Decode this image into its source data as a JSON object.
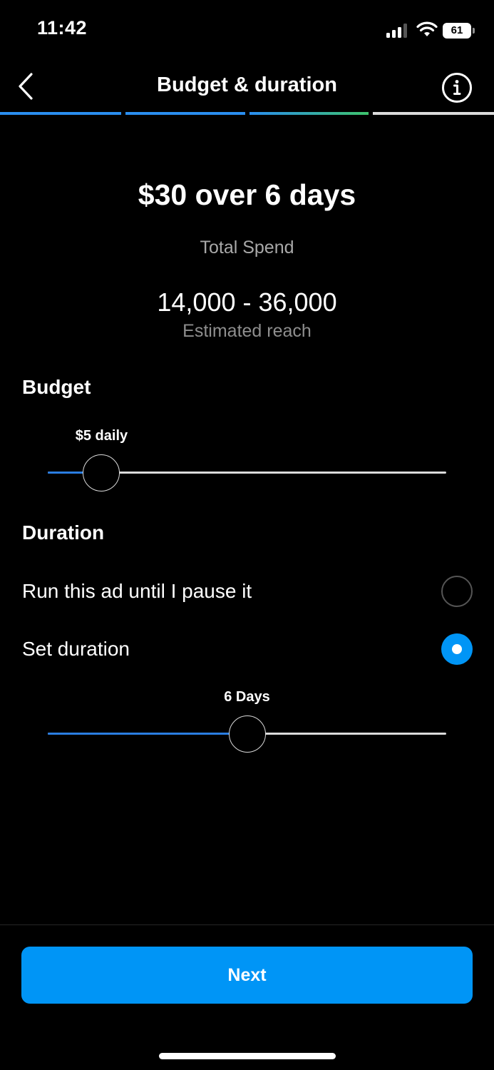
{
  "status_bar": {
    "time": "11:42",
    "battery": "61",
    "icons": [
      "signal-icon",
      "wifi-icon",
      "battery-icon"
    ]
  },
  "header": {
    "title": "Budget & duration",
    "back_icon": "chevron-left-icon",
    "info_icon": "info-icon",
    "progress_steps": [
      {
        "state": "complete"
      },
      {
        "state": "complete"
      },
      {
        "state": "current"
      },
      {
        "state": "pending"
      }
    ]
  },
  "summary": {
    "headline": "$30 over 6 days",
    "subtitle": "Total Spend",
    "reach_range": "14,000 - 36,000",
    "reach_label": "Estimated reach"
  },
  "budget": {
    "label": "Budget",
    "value_label": "$5 daily",
    "slider_fraction": 0.135
  },
  "duration": {
    "label": "Duration",
    "options": [
      {
        "label": "Run this ad until I pause it",
        "selected": false
      },
      {
        "label": "Set duration",
        "selected": true
      }
    ],
    "value_label": "6 Days",
    "slider_fraction": 0.5
  },
  "footer": {
    "next_label": "Next"
  },
  "colors": {
    "accent": "#0095f6",
    "background": "#000000",
    "text": "#ffffff",
    "muted_text": "#a8a8a8",
    "track": "#dbdbdb",
    "slider_fill": "#2a7de1",
    "gradient_end": "#3ec46d"
  }
}
